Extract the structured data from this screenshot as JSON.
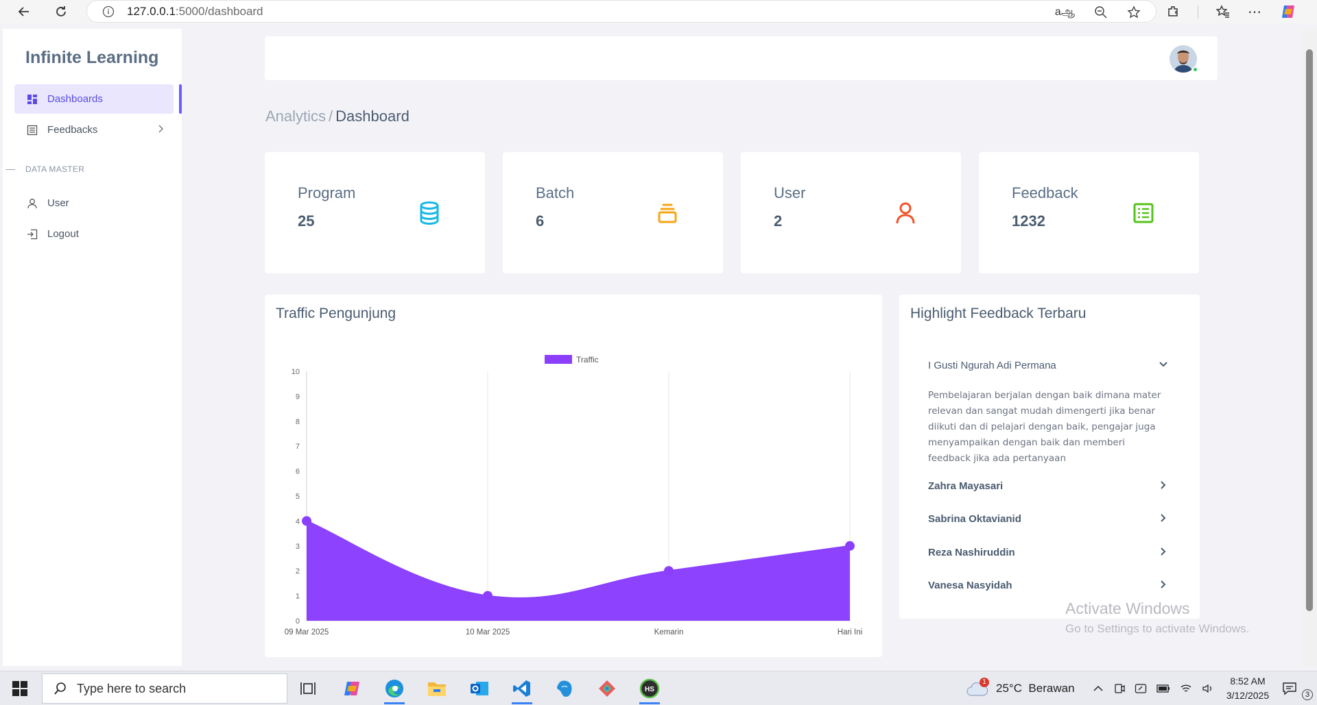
{
  "browser": {
    "url_host": "127.0.0.1",
    "url_path": ":5000/dashboard"
  },
  "sidebar": {
    "brand": "Infinite Learning",
    "items": [
      {
        "label": "Dashboards",
        "icon": "grid-icon",
        "active": true
      },
      {
        "label": "Feedbacks",
        "icon": "list-icon",
        "has_chevron": true
      }
    ],
    "section_label": "DATA MASTER",
    "master_items": [
      {
        "label": "User",
        "icon": "user-icon"
      },
      {
        "label": "Logout",
        "icon": "logout-icon"
      }
    ]
  },
  "breadcrumb": {
    "parent": "Analytics",
    "separator": "/",
    "current": "Dashboard"
  },
  "stats": [
    {
      "label": "Program",
      "value": "25",
      "icon": "database-icon",
      "color": "#17b8e6"
    },
    {
      "label": "Batch",
      "value": "6",
      "icon": "layers-icon",
      "color": "#f6a516"
    },
    {
      "label": "User",
      "value": "2",
      "icon": "user-icon",
      "color": "#f0532b"
    },
    {
      "label": "Feedback",
      "value": "1232",
      "icon": "table-icon",
      "color": "#55c21a"
    }
  ],
  "traffic_panel": {
    "title": "Traffic Pengunjung"
  },
  "chart_data": {
    "type": "area",
    "categories": [
      "09 Mar 2025",
      "10 Mar 2025",
      "Kemarin",
      "Hari Ini"
    ],
    "series": [
      {
        "name": "Traffic",
        "values": [
          4,
          1,
          2,
          3
        ],
        "color": "#8b3ffd"
      }
    ],
    "ylim": [
      0,
      10
    ],
    "yticks": [
      "0",
      "1",
      "2",
      "3",
      "4",
      "5",
      "6",
      "7",
      "8",
      "9",
      "10"
    ],
    "grid": "vertical",
    "legend": "top-center"
  },
  "feedback_panel": {
    "title": "Highlight Feedback Terbaru",
    "expanded": {
      "name": "I Gusti Ngurah Adi Permana",
      "text": "Pembelajaran berjalan dengan baik dimana mater relevan dan sangat mudah dimengerti jika benar diikuti dan di pelajari dengan baik, pengajar juga menyampaikan dengan baik dan memberi feedback jika ada pertanyaan"
    },
    "items": [
      {
        "name": "Zahra Mayasari"
      },
      {
        "name": "Sabrina Oktavianid"
      },
      {
        "name": "Reza Nashiruddin"
      },
      {
        "name": "Vanesa Nasyidah"
      }
    ]
  },
  "watermark": {
    "line1": "Activate Windows",
    "line2": "Go to Settings to activate Windows."
  },
  "taskbar": {
    "search_placeholder": "Type here to search",
    "weather": "25°C  Berawan",
    "weather_badge": "1",
    "time": "8:52 AM",
    "date": "3/12/2025",
    "notification_count": "3"
  }
}
